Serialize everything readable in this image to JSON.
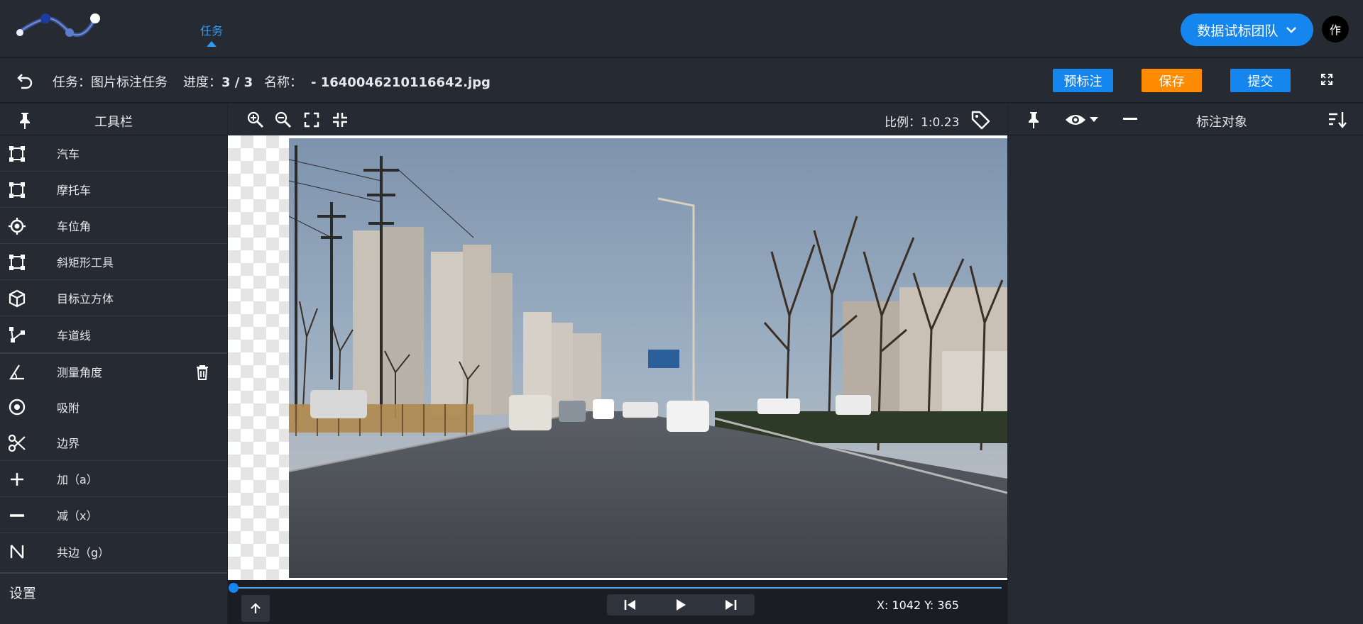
{
  "topbar": {
    "nav_tab": "任务",
    "team_button": "数据试标团队",
    "avatar_text": "作"
  },
  "infobar": {
    "task_label": "任务：",
    "task_value": "图片标注任务",
    "progress_label": "进度：",
    "progress_value": "3 / 3",
    "name_label": "名称：",
    "name_value": "- 1640046210116642.jpg",
    "pre_label_button": "预标注",
    "save_button": "保存",
    "submit_button": "提交"
  },
  "left_panel": {
    "title": "工具栏",
    "tools": [
      {
        "label": "汽车",
        "icon": "bounding-box-icon"
      },
      {
        "label": "摩托车",
        "icon": "bounding-box-icon"
      },
      {
        "label": "车位角",
        "icon": "crosshair-icon"
      },
      {
        "label": "斜矩形工具",
        "icon": "bounding-box-icon"
      },
      {
        "label": "目标立方体",
        "icon": "cube-icon"
      },
      {
        "label": "车道线",
        "icon": "polyline-icon"
      },
      {
        "label": "测量角度",
        "icon": "angle-icon"
      },
      {
        "label": "吸附",
        "icon": "target-icon"
      },
      {
        "label": "边界",
        "icon": "scissors-icon"
      },
      {
        "label": "加（a）",
        "icon": "plus-icon"
      },
      {
        "label": "减（x）",
        "icon": "minus-icon"
      },
      {
        "label": "共边（g）",
        "icon": "shared-edge-icon"
      }
    ],
    "settings_label": "设置"
  },
  "center": {
    "scale_label": "比例：",
    "scale_value": "1:0.23",
    "coords": "X: 1042 Y: 365",
    "timeline_progress": 0
  },
  "right_panel": {
    "title": "标注对象"
  },
  "colors": {
    "accent_blue": "#1586ee",
    "save_orange": "#ff8c00",
    "panel_bg": "#262a33"
  }
}
